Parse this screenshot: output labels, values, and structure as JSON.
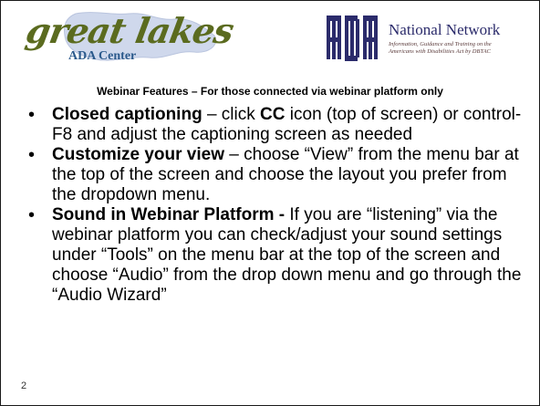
{
  "logos": {
    "great_lakes": {
      "script": "great lakes",
      "subtitle": "ADA Center",
      "colors": {
        "script": "#5b6b1f",
        "subtitle": "#2c5a8c",
        "map": "#cfd8ec"
      }
    },
    "ada_network": {
      "mark": "ADA",
      "title": "National Network",
      "tagline": [
        "Information, Guidance and Training on the",
        "Americans with Disabilities Act by DBTAC"
      ],
      "colors": {
        "mark": "#2b2b6b",
        "title": "#2b2b6b"
      }
    }
  },
  "subtitle": "Webinar Features – For those connected via webinar platform only",
  "bullets": [
    {
      "lead": "Closed captioning",
      "segments": [
        {
          "text": " – click ",
          "bold": false
        },
        {
          "text": "CC",
          "bold": true
        },
        {
          "text": " icon (top of screen) or control-F8 and adjust the captioning screen as needed",
          "bold": false
        }
      ]
    },
    {
      "lead": "Customize your view",
      "segments": [
        {
          "text": " – choose “View” from the menu bar at the top of the screen and choose the layout you prefer from the dropdown menu.",
          "bold": false
        }
      ]
    },
    {
      "lead": "Sound in Webinar Platform -",
      "segments": [
        {
          "text": " If you are “listening” via the webinar platform you can check/adjust your sound settings under “Tools” on the menu bar at the top of the screen and choose “Audio” from the drop down menu and go through the “Audio Wizard”",
          "bold": false
        }
      ]
    }
  ],
  "slide_number": "2"
}
